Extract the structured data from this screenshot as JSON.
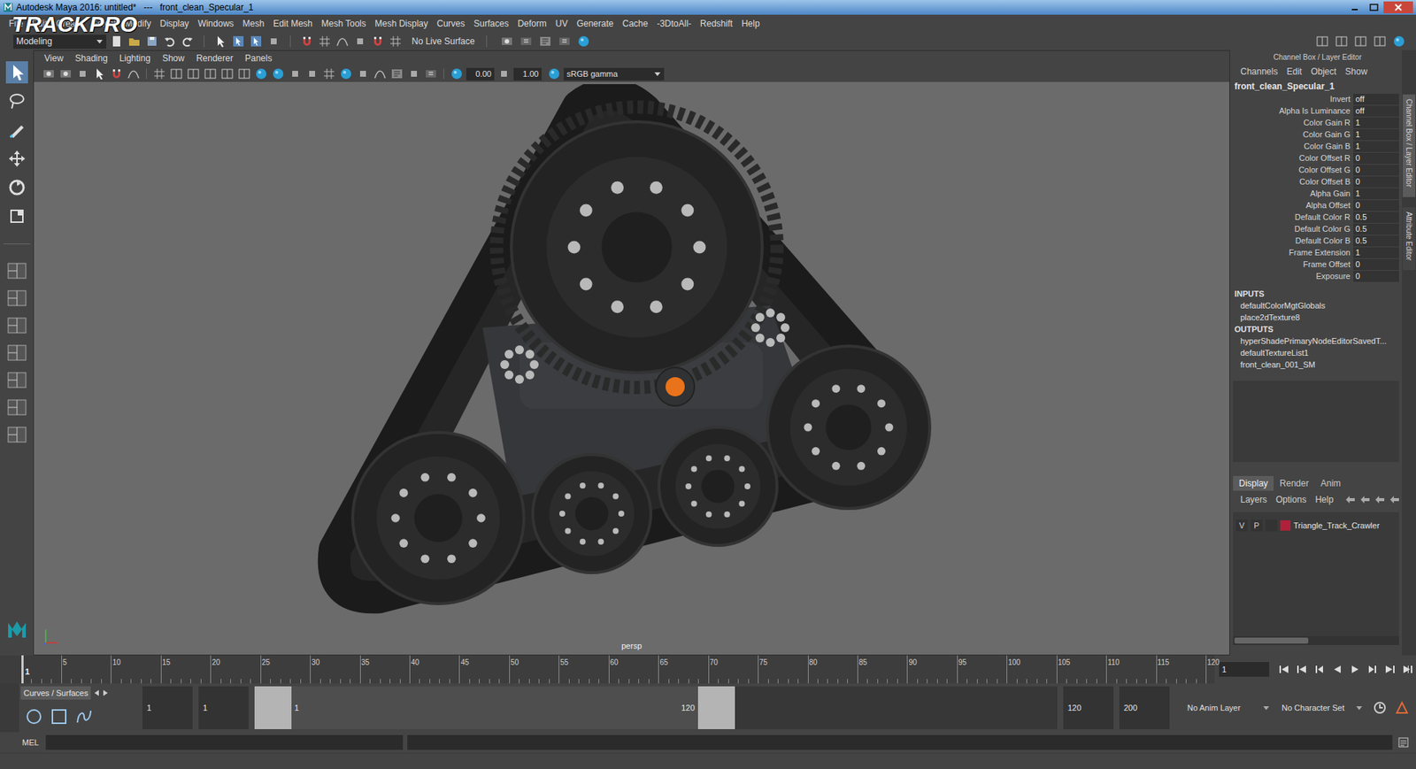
{
  "window": {
    "title": "Autodesk Maya 2016: untitled*   ---   front_clean_Specular_1"
  },
  "watermark": "TRACKPRO",
  "menubar": [
    "File",
    "Edit",
    "Create",
    "Select",
    "Modify",
    "Display",
    "Windows",
    "Mesh",
    "Edit Mesh",
    "Mesh Tools",
    "Mesh Display",
    "Curves",
    "Surfaces",
    "Deform",
    "UV",
    "Generate",
    "Cache",
    "-3DtoAll-",
    "Redshift",
    "Help"
  ],
  "statusline": {
    "mode": "Modeling",
    "live_surface": "No Live Surface"
  },
  "viewport": {
    "menus": [
      "View",
      "Shading",
      "Lighting",
      "Show",
      "Renderer",
      "Panels"
    ],
    "near": "0.00",
    "gain": "1.00",
    "color_space": "sRGB gamma",
    "camera": "persp"
  },
  "channel_box": {
    "header": "Channel Box / Layer Editor",
    "menus": [
      "Channels",
      "Edit",
      "Object",
      "Show"
    ],
    "node": "front_clean_Specular_1",
    "attributes": [
      {
        "name": "Invert",
        "value": "off"
      },
      {
        "name": "Alpha Is Luminance",
        "value": "off"
      },
      {
        "name": "Color Gain R",
        "value": "1"
      },
      {
        "name": "Color Gain G",
        "value": "1"
      },
      {
        "name": "Color Gain B",
        "value": "1"
      },
      {
        "name": "Color Offset R",
        "value": "0"
      },
      {
        "name": "Color Offset G",
        "value": "0"
      },
      {
        "name": "Color Offset B",
        "value": "0"
      },
      {
        "name": "Alpha Gain",
        "value": "1"
      },
      {
        "name": "Alpha Offset",
        "value": "0"
      },
      {
        "name": "Default Color R",
        "value": "0.5"
      },
      {
        "name": "Default Color G",
        "value": "0.5"
      },
      {
        "name": "Default Color B",
        "value": "0.5"
      },
      {
        "name": "Frame Extension",
        "value": "1"
      },
      {
        "name": "Frame Offset",
        "value": "0"
      },
      {
        "name": "Exposure",
        "value": "0"
      }
    ],
    "inputs_label": "INPUTS",
    "inputs": [
      "defaultColorMgtGlobals",
      "place2dTexture8"
    ],
    "outputs_label": "OUTPUTS",
    "outputs": [
      "hyperShadePrimaryNodeEditorSavedT...",
      "defaultTextureList1",
      "front_clean_001_SM"
    ]
  },
  "side_tabs": [
    {
      "label": "Channel Box / Layer Editor",
      "selected": true
    },
    {
      "label": "Attribute Editor",
      "selected": false
    }
  ],
  "layer_editor": {
    "tabs": [
      {
        "label": "Display",
        "selected": true
      },
      {
        "label": "Render",
        "selected": false
      },
      {
        "label": "Anim",
        "selected": false
      }
    ],
    "menus": [
      "Layers",
      "Options",
      "Help"
    ],
    "layers": [
      {
        "visible": "V",
        "playback": "P",
        "name": "Triangle_Track_Crawler",
        "color": "#b0203a"
      }
    ]
  },
  "timeline": {
    "ticks": [
      "5",
      "10",
      "15",
      "20",
      "25",
      "30",
      "35",
      "40",
      "45",
      "50",
      "55",
      "60",
      "65",
      "70",
      "75",
      "80",
      "85",
      "90",
      "95",
      "100",
      "105",
      "110",
      "115",
      "120"
    ],
    "playhead": "1",
    "current_frame": "1"
  },
  "range": {
    "shelf_tab": "Curves / Surfaces",
    "start": "1",
    "range_start": "1",
    "slider_start": "1",
    "slider_end": "120",
    "range_end": "120",
    "end": "200",
    "anim_layer": "No Anim Layer",
    "character_set": "No Character Set"
  },
  "command_line": {
    "language": "MEL"
  }
}
